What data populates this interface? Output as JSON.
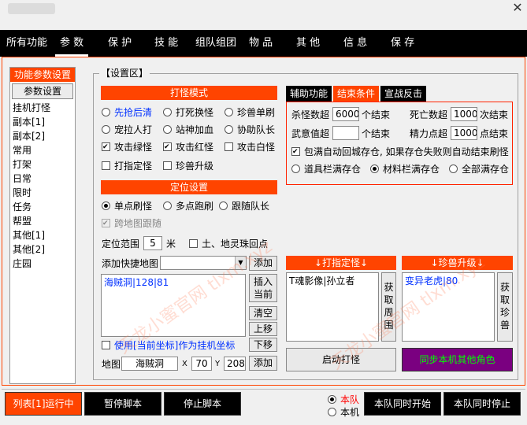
{
  "menu": [
    "所有功能",
    "参 数",
    "保 护",
    "技 能",
    "组队组团",
    "物 品",
    "其 他",
    "信 息",
    "保 存"
  ],
  "left_nav": {
    "header": "功能参数设置",
    "button": "参数设置",
    "items": [
      "挂机打怪",
      "副本[1]",
      "副本[2]",
      "常用",
      "打架",
      "日常",
      "限时",
      "任务",
      "帮盟",
      "其他[1]",
      "其他[2]",
      "庄园"
    ]
  },
  "settings": {
    "title": "【设置区】",
    "attack": {
      "header": "打怪模式",
      "opts": [
        "先抢后清",
        "打死换怪",
        "珍兽单刷",
        "宠拉人打",
        "站神加血",
        "协助队长"
      ],
      "checks": [
        "攻击绿怪",
        "攻击红怪",
        "攻击白怪",
        "打指定怪",
        "珍兽升级"
      ]
    },
    "position": {
      "header": "定位设置",
      "opts": [
        "单点刷怪",
        "多点跑刷",
        "跟随队长"
      ],
      "follow_map": "跨地图跟随",
      "range_label": "定位范围",
      "range_value": "5",
      "range_unit": "米",
      "earth_label": "土、地灵珠回点",
      "add_map_label": "添加快捷地图",
      "add_btn": "添加",
      "list_item": "海贼洞|128|81",
      "side_btns": [
        "插入当前",
        "清空",
        "上移",
        "下移"
      ],
      "use_coord": "使用[当前坐标]作为挂机坐标",
      "map_label": "地图",
      "map_value": "海贼洞",
      "x_label": "X",
      "x_value": "70",
      "y_label": "Y",
      "y_value": "208",
      "add_btn2": "添加"
    },
    "tabs": [
      "辅助功能",
      "结束条件",
      "宣战反击"
    ],
    "end": {
      "kill_label": "杀怪数超",
      "kill_value": "6000",
      "kill_unit": "个结束",
      "death_label": "死亡数超",
      "death_value": "1000",
      "death_unit": "次结束",
      "wu_label": "武意值超",
      "wu_value": "",
      "wu_unit": "个结束",
      "energy_label": "精力点超",
      "energy_value": "1000",
      "energy_unit": "点结束",
      "full_bag": "包满自动回城存仓, 如果存仓失败则自动结束刷怪",
      "radios": [
        "道具栏满存仓",
        "材料栏满存仓",
        "全部满存仓"
      ]
    },
    "target_mob": {
      "header": "↓打指定怪↓",
      "item": "T魂影像|孙立者",
      "fetch": "获取周围"
    },
    "pet_up": {
      "header": "↓珍兽升级↓",
      "item": "变异老虎|80",
      "fetch": "获取珍兽"
    },
    "start_btn": "启动打怪",
    "sync_btn": "同步本机其他角色"
  },
  "footer": {
    "run": "列表[1]运行中",
    "pause": "暂停脚本",
    "stop": "停止脚本",
    "team": "本队",
    "local": "本机",
    "sync_start": "本队同时开始",
    "sync_stop": "本队同时停止"
  },
  "watermark": "天龙小蜜官网 tlxm.xyz",
  "colors": {
    "accent": "#ff4400",
    "purple": "#7a0080",
    "green": "#00ff00"
  }
}
